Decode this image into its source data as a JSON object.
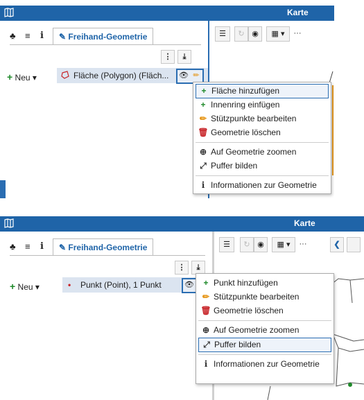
{
  "panel1": {
    "window_title": "Karte",
    "tab_label": "Freihand-Geometrie",
    "new_button": "Neu",
    "item_label": "Fläche (Polygon) (Fläch...",
    "menu_items": [
      {
        "label": "Fläche hinzufügen",
        "icon": "plus-icon"
      },
      {
        "label": "Innenring einfügen",
        "icon": "plus-icon"
      },
      {
        "label": "Stützpunkte bearbeiten",
        "icon": "pencil-icon"
      },
      {
        "label": "Geometrie löschen",
        "icon": "trash-icon"
      },
      {
        "label": "Auf Geometrie zoomen",
        "icon": "zoom-icon"
      },
      {
        "label": "Puffer bilden",
        "icon": "expand-icon"
      },
      {
        "label": "Informationen zur Geometrie",
        "icon": "info-icon"
      }
    ],
    "highlighted_item": "Fläche hinzufügen"
  },
  "panel2": {
    "window_title": "Karte",
    "tab_label": "Freihand-Geometrie",
    "new_button": "Neu",
    "item_label": "Punkt (Point), 1 Punkt",
    "menu_items": [
      {
        "label": "Punkt hinzufügen",
        "icon": "plus-icon"
      },
      {
        "label": "Stützpunkte bearbeiten",
        "icon": "pencil-icon"
      },
      {
        "label": "Geometrie löschen",
        "icon": "trash-icon"
      },
      {
        "label": "Auf Geometrie zoomen",
        "icon": "zoom-icon"
      },
      {
        "label": "Puffer bilden",
        "icon": "expand-icon"
      },
      {
        "label": "Informationen zur Geometrie",
        "icon": "info-icon"
      }
    ],
    "highlighted_item": "Puffer bilden"
  },
  "colors": {
    "titlebar": "#1f64a8",
    "accent_border": "#2a6db2",
    "add_green": "#1f8a2a",
    "edit_orange": "#e69516",
    "delete_red": "#c8262a",
    "item_row": "#dbe4f0"
  }
}
